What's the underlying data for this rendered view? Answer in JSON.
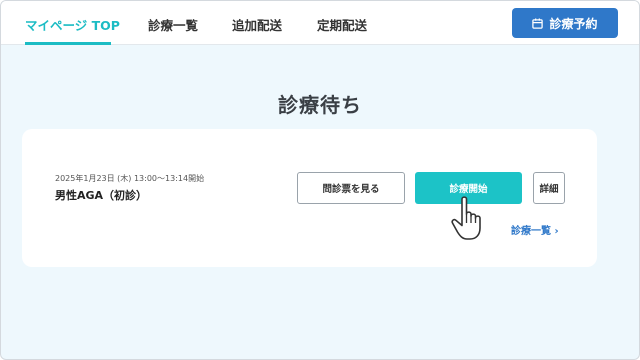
{
  "nav": {
    "items": [
      {
        "label": "マイページ TOP",
        "active": true
      },
      {
        "label": "診療一覧",
        "active": false
      },
      {
        "label": "追加配送",
        "active": false
      },
      {
        "label": "定期配送",
        "active": false
      }
    ],
    "reserve_button": {
      "label": "診療予約",
      "icon": "calendar-icon"
    }
  },
  "main": {
    "title": "診療待ち",
    "appointment": {
      "datetime": "2025年1月23日 (木) 13:00～13:14開始",
      "name": "男性AGA（初診）",
      "questionnaire_button": "問診票を見る",
      "start_button": "診療開始",
      "detail_button": "詳細",
      "list_link": "診療一覧 ›"
    }
  },
  "colors": {
    "accent": "#1cbcc4",
    "primary": "#2f78c9",
    "background": "#eef8fd"
  },
  "icons": {
    "cursor": "hand-pointer-icon"
  }
}
